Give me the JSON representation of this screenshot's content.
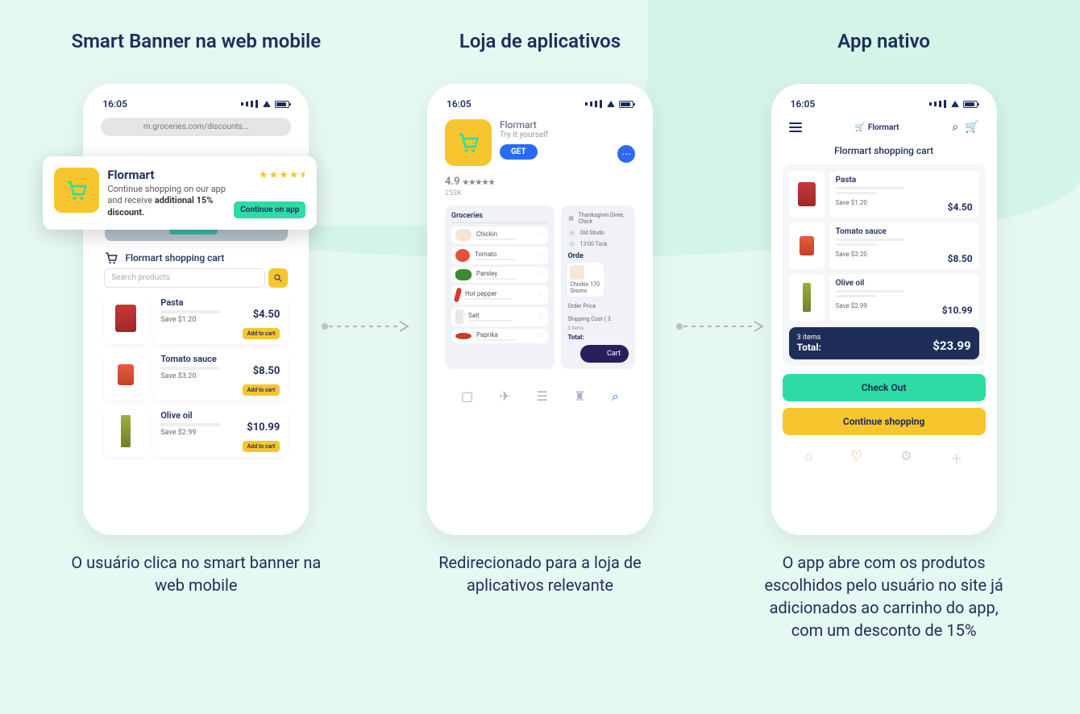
{
  "columns": [
    {
      "title": "Smart Banner na web mobile",
      "caption": "O usuário clica no smart banner na web mobile"
    },
    {
      "title": "Loja de aplicativos",
      "caption": "Redirecionado para a loja de aplicativos relevante"
    },
    {
      "title": "App nativo",
      "caption": "O app abre com os produtos escolhidos pelo usuário no site já adicionados ao carrinho do app, com um desconto de 15%"
    }
  ],
  "status": {
    "time": "16:05"
  },
  "phone1": {
    "url": "m.groceries.com/discounts...",
    "banner": {
      "title": "Flormart",
      "text": "Continue shopping on our app and receive ",
      "bold": "additional 15% discount.",
      "cta": "Continue on app",
      "stars": "★★★★⯨"
    },
    "shop_header": "Flormart shopping cart",
    "search_placeholder": "Search products",
    "products": [
      {
        "name": "Pasta",
        "save": "Save $1.20",
        "price": "$4.50",
        "cta": "Add to cart"
      },
      {
        "name": "Tomato sauce",
        "save": "Save $3.20",
        "price": "$8.50",
        "cta": "Add to cart"
      },
      {
        "name": "Olive oil",
        "save": "Save $2.99",
        "price": "$10.99",
        "cta": "Add to cart"
      }
    ]
  },
  "phone2": {
    "app_name": "Flormart",
    "sub": "Try it yourself",
    "get": "GET",
    "rating": "4.9",
    "stars": "★★★★★",
    "count": "253K",
    "screen1": {
      "title": "Groceries",
      "items": [
        "Chickin",
        "Tomato",
        "Parsley",
        "Hot pepper",
        "Salt",
        "Paprika"
      ]
    },
    "screen2": {
      "rows": [
        "Thanksgivin Diner, Chick",
        "Old Studo",
        "13:00 Tock"
      ],
      "orde_label": "Orde",
      "orde_item": "Chickin 170 Groms",
      "order_price": "Order Price",
      "shipping": "Shipping Cost ( 3.",
      "items_label": "3 items",
      "total_label": "Total:",
      "btn": "Cart"
    }
  },
  "phone3": {
    "logo": "Flormart",
    "title": "Flormart shopping cart",
    "items": [
      {
        "name": "Pasta",
        "save": "Save $1.20",
        "price": "$4.50"
      },
      {
        "name": "Tomato sauce",
        "save": "Save $3.20",
        "price": "$8.50"
      },
      {
        "name": "Olive oil",
        "save": "Save $2.99",
        "price": "$10.99"
      }
    ],
    "totals": {
      "count": "3 items",
      "label": "Total:",
      "value": "$23.99"
    },
    "checkout": "Check Out",
    "continue": "Continue shopping"
  }
}
